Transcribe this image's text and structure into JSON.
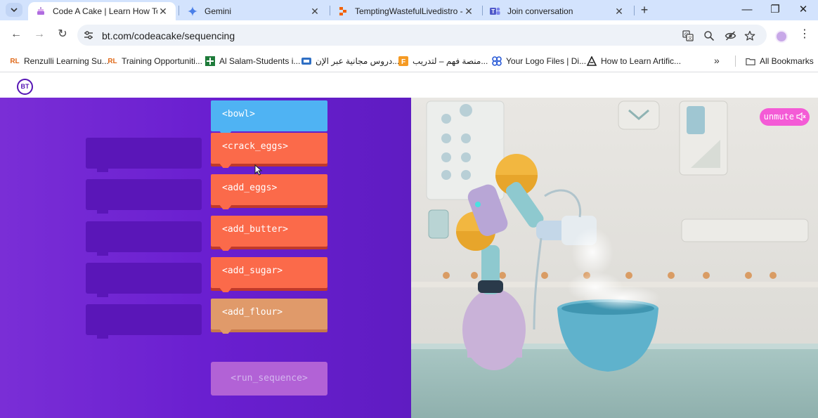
{
  "browser": {
    "tabs": [
      {
        "title": "Code A Cake | Learn How To Co",
        "active": true
      },
      {
        "title": "Gemini",
        "active": false
      },
      {
        "title": "TemptingWastefulLivedistro - R",
        "active": false
      },
      {
        "title": "Join conversation",
        "active": false
      }
    ],
    "new_tab_label": "+",
    "window_controls": {
      "minimize": "—",
      "restore": "❐",
      "close": "✕"
    },
    "url": "bt.com/codeacake/sequencing",
    "nav": {
      "back": "←",
      "forward": "→",
      "reload": "↻"
    },
    "bookmarks": [
      {
        "label": "Renzulli Learning Su...",
        "icon": "renzulli-icon"
      },
      {
        "label": "Training Opportuniti...",
        "icon": "renzulli-icon"
      },
      {
        "label": "Al Salam-Students i...",
        "icon": "plus-cross-icon"
      },
      {
        "label": "دروس مجانية عبر الإن...",
        "icon": "video-icon"
      },
      {
        "label": "منصة فهم – لتدريب...",
        "icon": "f-square-icon"
      },
      {
        "label": "Your Logo Files | Di...",
        "icon": "logo-files-icon"
      },
      {
        "label": "How to Learn Artific...",
        "icon": "triangle-logo-icon"
      }
    ],
    "bookmarks_overflow": "»",
    "all_bookmarks_label": "All Bookmarks"
  },
  "site": {
    "logo_text": "BT"
  },
  "game": {
    "blocks": [
      {
        "label": "<bowl>",
        "color": "#4fb3f3"
      },
      {
        "label": "<crack_eggs>",
        "color": "#fb6a4a"
      },
      {
        "label": "<add_eggs>",
        "color": "#fb6a4a"
      },
      {
        "label": "<add_butter>",
        "color": "#fb6a4a"
      },
      {
        "label": "<add_sugar>",
        "color": "#fb6a4a"
      },
      {
        "label": "<add_flour>",
        "color": "#e09a6a"
      }
    ],
    "empty_slot_count": 5,
    "run_button_label": "<run_sequence>"
  },
  "video": {
    "unmute_label": "unmute"
  },
  "colors": {
    "purple_panel": "#6a1fd0",
    "slot": "#5a16b8",
    "run_button": "#b262d6",
    "unmute": "#f45bd6"
  }
}
